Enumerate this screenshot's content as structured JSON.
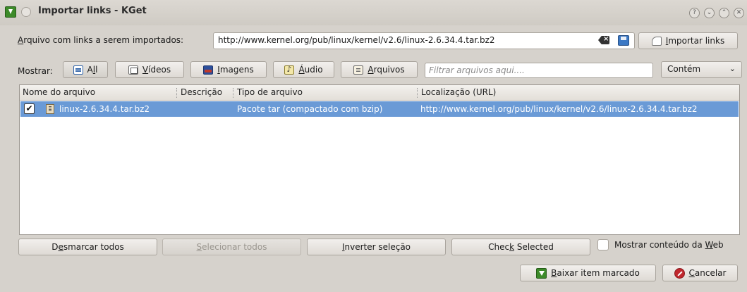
{
  "window": {
    "title": "Importar links - KGet",
    "controls": [
      "?",
      "⌄",
      "⌃",
      "✕"
    ]
  },
  "import_row": {
    "label_prefix": "A",
    "label_rest": "rquivo com links a serem importados:",
    "url_value": "http://www.kernel.org/pub/linux/kernel/v2.6/linux-2.6.34.4.tar.bz2",
    "clear_icon": "backspace-clear-icon",
    "save_icon": "floppy-save-icon",
    "import_button": {
      "pre": "",
      "accel": "I",
      "post": "mportar links"
    }
  },
  "filter_row": {
    "show_label": "Mostrar:",
    "buttons": [
      {
        "pre": "A",
        "accel": "l",
        "post": "l",
        "icon": "list-icon"
      },
      {
        "pre": "",
        "accel": "V",
        "post": "ídeos",
        "icon": "video-icon"
      },
      {
        "pre": "",
        "accel": "I",
        "post": "magens",
        "icon": "image-icon"
      },
      {
        "pre": "",
        "accel": "Á",
        "post": "udio",
        "icon": "audio-icon"
      },
      {
        "pre": "",
        "accel": "A",
        "post": "rquivos",
        "icon": "file-icon"
      }
    ],
    "filter_placeholder": "Filtrar arquivos aqui....",
    "match_select": "Contém"
  },
  "table": {
    "columns": [
      "Nome do arquivo",
      "Descrição",
      "Tipo de arquivo",
      "Localização (URL)"
    ],
    "rows": [
      {
        "checked": true,
        "name": "linux-2.6.34.4.tar.bz2",
        "description": "",
        "type": "Pacote tar (compactado com bzip)",
        "location": "http://www.kernel.org/pub/linux/kernel/v2.6/linux-2.6.34.4.tar.bz2"
      }
    ]
  },
  "actions": {
    "deselect_all": {
      "pre": "D",
      "accel": "e",
      "post": "smarcar todos"
    },
    "select_all": {
      "pre": "",
      "accel": "S",
      "post": "elecionar todos"
    },
    "invert": {
      "pre": "",
      "accel": "I",
      "post": "nverter seleção"
    },
    "check_selected": {
      "pre": "Chec",
      "accel": "k",
      "post": " Selected"
    },
    "show_web": {
      "pre": "Mostrar conteúdo da ",
      "accel": "W",
      "post": "eb"
    }
  },
  "footer": {
    "download": {
      "pre": "",
      "accel": "B",
      "post": "aixar item marcado"
    },
    "cancel": {
      "pre": "",
      "accel": "C",
      "post": "ancelar"
    }
  }
}
